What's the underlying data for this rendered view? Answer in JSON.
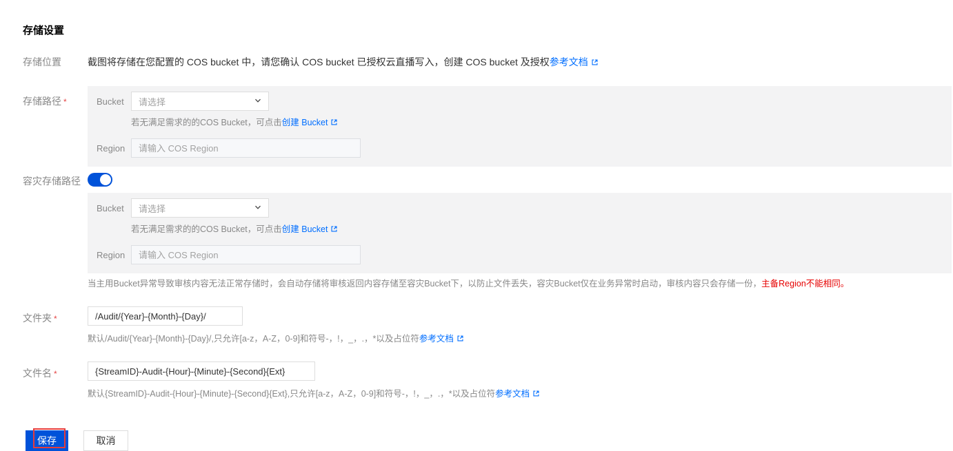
{
  "page": {
    "title": "存储设置"
  },
  "colors": {
    "accent_link_blue": "#006eff",
    "primary_button_blue": "#0052d9",
    "toggle_on_blue": "#0052d9",
    "warning_red": "#e60000",
    "required_asterisk_red": "#e54545",
    "panel_gray": "#f3f3f4",
    "annotation_box_red": "#e63c3c"
  },
  "icons": {
    "external_link": "external-link-icon",
    "chevron_down": "chevron-down-icon"
  },
  "storage_location": {
    "label": "存储位置",
    "text": "截图将存储在您配置的 COS bucket 中，请您确认 COS bucket 已授权云直播写入，创建 COS bucket 及授权",
    "link": "参考文档"
  },
  "storage_path": {
    "label": "存储路径",
    "required": "*"
  },
  "bucket_panel": {
    "bucket_label": "Bucket",
    "bucket_placeholder": "请选择",
    "helper_prefix": "若无满足需求的的COS Bucket，可点击",
    "helper_link": "创建 Bucket",
    "region_label": "Region",
    "region_placeholder": "请输入 COS Region"
  },
  "disaster": {
    "label": "容灾存储路径",
    "toggle_state": "on",
    "warning_text": "当主用Bucket异常导致审核内容无法正常存储时，会自动存储将审核返回内容存储至容灾Bucket下，以防止文件丢失，容灾Bucket仅在业务异常时启动，审核内容只会存储一份，",
    "warning_red": "主备Region不能相同。"
  },
  "folder": {
    "label": "文件夹",
    "required": "*",
    "value": "/Audit/{Year}-{Month}-{Day}/",
    "helper_prefix": "默认/Audit/{Year}-{Month}-{Day}/,只允许[a-z，A-Z，0-9]和符号-，!，_，.，*以及占位符",
    "helper_link": "参考文档"
  },
  "filename": {
    "label": "文件名",
    "required": "*",
    "value": "{StreamID}-Audit-{Hour}-{Minute}-{Second}{Ext}",
    "helper_prefix": "默认{StreamID}-Audit-{Hour}-{Minute}-{Second}{Ext},只允许[a-z，A-Z，0-9]和符号-，!，_，.，*以及占位符",
    "helper_link": "参考文档"
  },
  "actions": {
    "save": "保存",
    "cancel": "取消"
  }
}
